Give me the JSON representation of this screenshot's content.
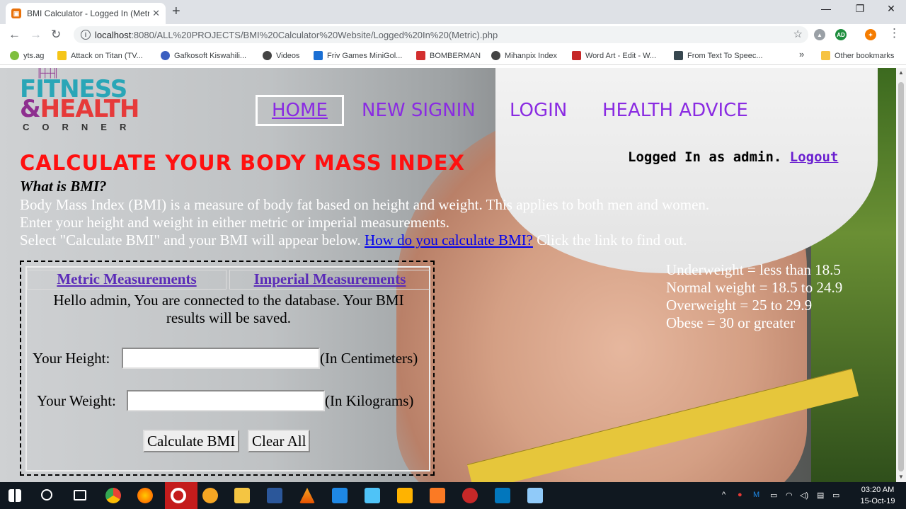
{
  "browser": {
    "tab_title": "BMI Calculator - Logged In (Metri",
    "tab_close": "✕",
    "new_tab": "+",
    "minimize": "—",
    "maximize": "❐",
    "close": "✕",
    "back": "←",
    "forward": "→",
    "reload": "↻",
    "url_host": "localhost",
    "url_path": ":8080/ALL%20PROJECTS/BMI%20Calculator%20Website/Logged%20In%20(Metric).php",
    "star": "☆",
    "menu_dots": "⋮",
    "bookmarks": [
      {
        "label": "yts.ag",
        "color": "#7fbf3f"
      },
      {
        "label": "Attack on Titan (TV...",
        "color": "#f5c518"
      },
      {
        "label": "Gafkosoft Kiswahili...",
        "color": "#3b5fc0"
      },
      {
        "label": "Videos",
        "color": "#444"
      },
      {
        "label": "Friv Games MiniGol...",
        "color": "#1a6fd4"
      },
      {
        "label": "BOMBERMAN",
        "color": "#d32f2f"
      },
      {
        "label": "Mihanpix Index",
        "color": "#444"
      },
      {
        "label": "Word Art - Edit - W...",
        "color": "#c62828"
      },
      {
        "label": "From Text To Speec...",
        "color": "#37474f"
      }
    ],
    "bookmarks_more": "»",
    "other_bookmarks": "Other bookmarks"
  },
  "site": {
    "logo": {
      "fitness": "FITNESS",
      "amp": "&",
      "health": "HEALTH",
      "corner": "CORNER"
    },
    "nav": [
      "HOME",
      "NEW SIGNIN",
      "LOGIN",
      "HEALTH ADVICE"
    ],
    "logged_in_text": "Logged In as admin.",
    "logout": "Logout",
    "heading": "CALCULATE YOUR BODY MASS INDEX",
    "what_is": "What is BMI?",
    "para1": "Body Mass Index (BMI) is a measure of body fat based on height and weight. This applies to both men and women.",
    "para2": "Enter your height and weight in either metric or imperial measurements.",
    "para3_prefix": "Select \"Calculate BMI\" and your BMI will appear below.",
    "para3_link": "How do you calculate BMI?",
    "para3_suffix": " Click the link to find out.",
    "categories": [
      "Underweight = less than 18.5",
      "Normal weight = 18.5 to 24.9",
      "Overweight = 25 to 29.9",
      "Obese = 30 or greater"
    ],
    "form": {
      "tab_metric": "Metric Measurements",
      "tab_imperial": "Imperial Measurements",
      "hello": "Hello admin, You are connected to the database. Your BMI results will be saved.",
      "height_label": "Your Height:",
      "height_value": "",
      "height_unit": "(In Centimeters)",
      "weight_label": "Your Weight:",
      "weight_value": "",
      "weight_unit": "(In Kilograms)",
      "calc_button": "Calculate BMI",
      "clear_button": "Clear All"
    }
  },
  "taskbar": {
    "time": "03:20 AM",
    "date": "15-Oct-19"
  }
}
